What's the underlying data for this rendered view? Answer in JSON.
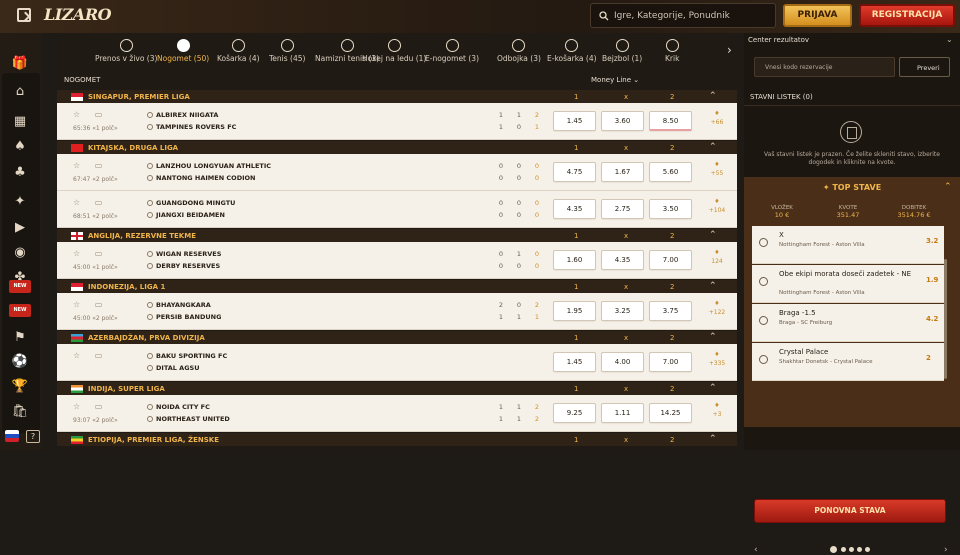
{
  "header": {
    "logo": "LIZARO",
    "search_placeholder": "Igre, Kategorije, Ponudnik",
    "login": "PRIJAVA",
    "register": "REGISTRACIJA"
  },
  "sidebar": {
    "icons": [
      "gift-icon",
      "home-icon",
      "casino-icon",
      "cards-icon",
      "dice-icon",
      "bonus-icon",
      "live-icon",
      "chips-icon",
      "clover-icon",
      "badge-new-1",
      "badge-new-2",
      "tournament-icon",
      "ball-icon",
      "trophy-icon",
      "shop-icon"
    ],
    "badge_label": "NEW",
    "help_label": "?"
  },
  "sports": [
    {
      "label": "Prenos v živo (3)",
      "icon": "tv-icon"
    },
    {
      "label": "Nogomet (50)",
      "icon": "soccer-icon",
      "active": true
    },
    {
      "label": "Košarka (4)",
      "icon": "basketball-icon"
    },
    {
      "label": "Tenis (45)",
      "icon": "tennis-icon"
    },
    {
      "label": "Namizni tenis (3)",
      "icon": "table-tennis-icon"
    },
    {
      "label": "Hokej na ledu (1)",
      "icon": "hockey-icon"
    },
    {
      "label": "E-nogomet (3)",
      "icon": "esoccer-icon"
    },
    {
      "label": "Odbojka (3)",
      "icon": "volleyball-icon"
    },
    {
      "label": "E-košarka (4)",
      "icon": "gamepad-icon"
    },
    {
      "label": "Bejzbol (1)",
      "icon": "baseball-icon"
    },
    {
      "label": "Krik",
      "icon": "cricket-icon"
    }
  ],
  "section": {
    "title": "NOGOMET",
    "market": "Money Line"
  },
  "columns": {
    "c1": "1",
    "cx": "x",
    "c2": "2"
  },
  "leagues": [
    {
      "name": "SINGAPUR, PREMIER LIGA",
      "flag": "sg",
      "matches": [
        {
          "time": "65:36 «1 polč»",
          "home": "ALBIREX NIIGATA",
          "away": "TAMPINES ROVERS FC",
          "home_scores": [
            "1",
            "1",
            "2"
          ],
          "away_scores": [
            "1",
            "0",
            "1"
          ],
          "odds": [
            "1.45",
            "3.60",
            "8.50"
          ],
          "more": "+66"
        }
      ]
    },
    {
      "name": "KITAJSKA, DRUGA LIGA",
      "flag": "cn",
      "matches": [
        {
          "time": "67:47 «2 polč»",
          "home": "LANZHOU LONGYUAN ATHLETIC",
          "away": "NANTONG HAIMEN CODION",
          "home_scores": [
            "0",
            "0",
            "0"
          ],
          "away_scores": [
            "0",
            "0",
            "0"
          ],
          "odds": [
            "4.75",
            "1.67",
            "5.60"
          ],
          "more": "+55"
        },
        {
          "time": "68:51 «2 polč»",
          "home": "GUANGDONG MINGTU",
          "away": "JIANGXI BEIDAMEN",
          "home_scores": [
            "0",
            "0",
            "0"
          ],
          "away_scores": [
            "0",
            "0",
            "0"
          ],
          "odds": [
            "4.35",
            "2.75",
            "3.50"
          ],
          "more": "+104"
        }
      ]
    },
    {
      "name": "ANGLIJA, REZERVNE TEKME",
      "flag": "en",
      "matches": [
        {
          "time": "45:00 «1 polč»",
          "home": "WIGAN RESERVES",
          "away": "DERBY RESERVES",
          "home_scores": [
            "0",
            "1",
            "0"
          ],
          "away_scores": [
            "0",
            "0",
            "0"
          ],
          "odds": [
            "1.60",
            "4.35",
            "7.00"
          ],
          "more": "124"
        }
      ]
    },
    {
      "name": "INDONEZIJA, LIGA 1",
      "flag": "id",
      "matches": [
        {
          "time": "45:00 «2 polč»",
          "home": "BHAYANGKARA",
          "away": "PERSIB BANDUNG",
          "home_scores": [
            "2",
            "0",
            "2"
          ],
          "away_scores": [
            "1",
            "1",
            "1"
          ],
          "odds": [
            "1.95",
            "3.25",
            "3.75"
          ],
          "more": "+122"
        }
      ]
    },
    {
      "name": "AZERBAJDŽAN, PRVA DIVIZIJA",
      "flag": "az",
      "matches": [
        {
          "time": "",
          "home": "BAKU SPORTING FC",
          "away": "DITAL AGSU",
          "home_scores": [
            "",
            "",
            ""
          ],
          "away_scores": [
            "",
            "",
            ""
          ],
          "odds": [
            "1.45",
            "4.00",
            "7.00"
          ],
          "more": "+335"
        }
      ]
    },
    {
      "name": "INDIJA, SUPER LIGA",
      "flag": "in",
      "matches": [
        {
          "time": "93:07 «2 polč»",
          "home": "NOIDA CITY FC",
          "away": "NORTHEAST UNITED",
          "home_scores": [
            "1",
            "1",
            "2"
          ],
          "away_scores": [
            "1",
            "1",
            "2"
          ],
          "odds": [
            "9.25",
            "1.11",
            "14.25"
          ],
          "more": "+3"
        }
      ]
    },
    {
      "name": "ETIOPIJA, PREMIER LIGA, ŽENSKE",
      "flag": "et",
      "matches": []
    }
  ],
  "right": {
    "results_title": "Center rezultatov",
    "code_placeholder": "Vnesi kodo rezervacije",
    "check": "Preveri",
    "slip_tab": "STAVNI LISTEK (0)",
    "slip_msg": "Vaš stavni listek je prazen. Če želite skleniti stavo, izberite dogodek in kliknite na kvote.",
    "top_title": "TOP STAVE",
    "stats": [
      {
        "label": "VLOŽEK",
        "value": "10 €"
      },
      {
        "label": "KVOTE",
        "value": "351.47"
      },
      {
        "label": "DOBITEK",
        "value": "3514.76 €"
      }
    ],
    "picks": [
      {
        "title": "X",
        "sub": "Nottingham Forest - Aston Villa",
        "odd": "3.2"
      },
      {
        "title": "Obe ekipi morata doseči zadetek - NE",
        "sub": "Nottingham Forest - Aston Villa",
        "odd": "1.9"
      },
      {
        "title": "Braga -1.5",
        "sub": "Braga - SC Freiburg",
        "odd": "4.2"
      },
      {
        "title": "Crystal Palace",
        "sub": "Shakhtar Donetsk - Crystal Palace",
        "odd": "2"
      }
    ],
    "again": "PONOVNA STAVA"
  }
}
